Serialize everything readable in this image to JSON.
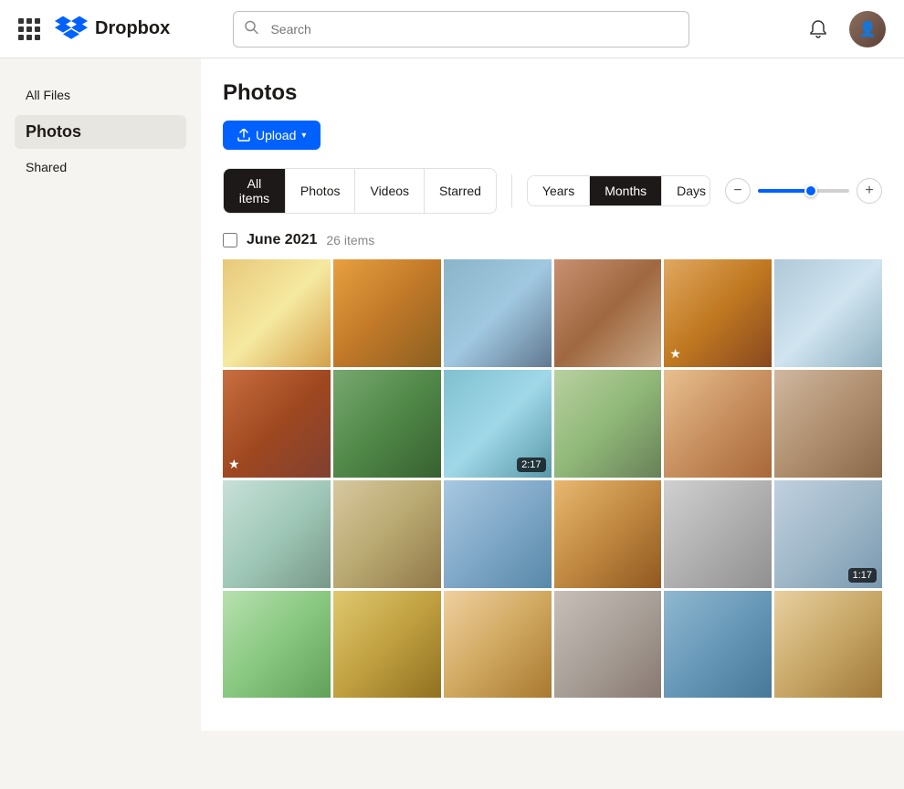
{
  "topbar": {
    "app_name": "Dropbox",
    "search_placeholder": "Search"
  },
  "sidebar": {
    "items": [
      {
        "id": "all-files",
        "label": "All Files",
        "active": false,
        "size": "normal"
      },
      {
        "id": "photos",
        "label": "Photos",
        "active": true,
        "size": "bold"
      },
      {
        "id": "shared",
        "label": "Shared",
        "active": false,
        "size": "normal"
      }
    ]
  },
  "main": {
    "title": "Photos",
    "upload_btn": "Upload",
    "filter_tabs": [
      {
        "id": "all-items",
        "label": "All items",
        "active": true
      },
      {
        "id": "photos",
        "label": "Photos",
        "active": false
      },
      {
        "id": "videos",
        "label": "Videos",
        "active": false
      },
      {
        "id": "starred",
        "label": "Starred",
        "active": false
      }
    ],
    "time_tabs": [
      {
        "id": "years",
        "label": "Years",
        "active": false
      },
      {
        "id": "months",
        "label": "Months",
        "active": true
      },
      {
        "id": "days",
        "label": "Days",
        "active": false
      }
    ],
    "month_section": {
      "label": "June 2021",
      "count": "26 items"
    },
    "photos": [
      {
        "id": 1,
        "color": "c1",
        "badge": null,
        "star": false
      },
      {
        "id": 2,
        "color": "c2",
        "badge": null,
        "star": false
      },
      {
        "id": 3,
        "color": "c3",
        "badge": null,
        "star": false
      },
      {
        "id": 4,
        "color": "c4",
        "badge": null,
        "star": false
      },
      {
        "id": 5,
        "color": "c5",
        "badge": null,
        "star": true
      },
      {
        "id": 6,
        "color": "c6",
        "badge": null,
        "star": false
      },
      {
        "id": 7,
        "color": "c7",
        "badge": null,
        "star": true
      },
      {
        "id": 8,
        "color": "c8",
        "badge": null,
        "star": false
      },
      {
        "id": 9,
        "color": "c9",
        "badge": "2:17",
        "star": false
      },
      {
        "id": 10,
        "color": "c10",
        "badge": null,
        "star": false
      },
      {
        "id": 11,
        "color": "c11",
        "badge": null,
        "star": false
      },
      {
        "id": 12,
        "color": "c12",
        "badge": null,
        "star": false
      },
      {
        "id": 13,
        "color": "c13",
        "badge": null,
        "star": false
      },
      {
        "id": 14,
        "color": "c14",
        "badge": null,
        "star": false
      },
      {
        "id": 15,
        "color": "c15",
        "badge": null,
        "star": false
      },
      {
        "id": 16,
        "color": "c16",
        "badge": null,
        "star": false
      },
      {
        "id": 17,
        "color": "c17",
        "badge": null,
        "star": false
      },
      {
        "id": 18,
        "color": "c18",
        "badge": "1:17",
        "star": false
      },
      {
        "id": 19,
        "color": "c19",
        "badge": null,
        "star": false
      },
      {
        "id": 20,
        "color": "c20",
        "badge": null,
        "star": false
      },
      {
        "id": 21,
        "color": "c21",
        "badge": null,
        "star": false
      },
      {
        "id": 22,
        "color": "c22",
        "badge": null,
        "star": false
      },
      {
        "id": 23,
        "color": "c23",
        "badge": null,
        "star": false
      },
      {
        "id": 24,
        "color": "c24",
        "badge": null,
        "star": false
      }
    ]
  }
}
